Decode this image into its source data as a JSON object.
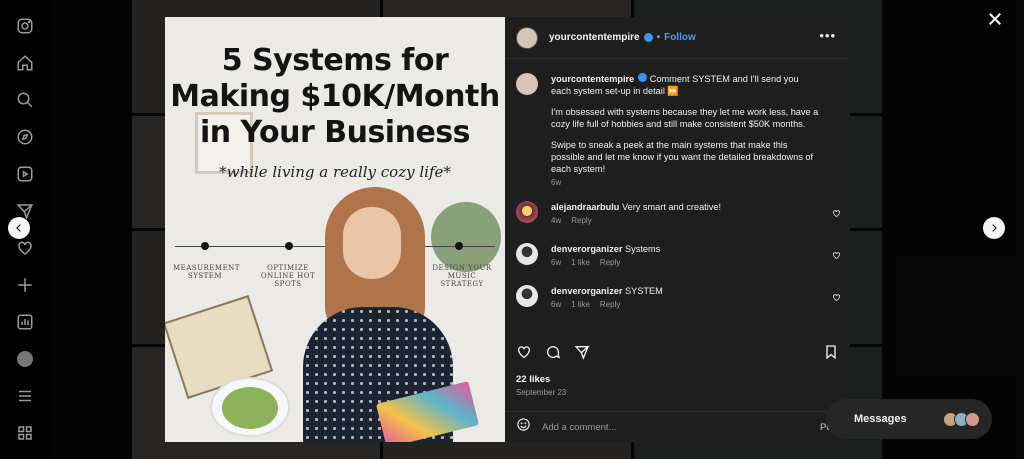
{
  "post": {
    "headline": "5 Systems for Making $10K/Month in Your Business",
    "subheadline": "*while living a really cozy life*",
    "timeline_labels": [
      "MEASUREMENT SYSTEM",
      "OPTIMIZE ONLINE HOT SPOTS",
      "DESIGN YOUR MUSIC STRATEGY"
    ]
  },
  "header": {
    "username": "yourcontentempire",
    "separator": "•",
    "follow_label": "Follow",
    "more_label": "•••"
  },
  "caption": {
    "username": "yourcontentempire",
    "text_1": " Comment SYSTEM and I'll send you each system set-up in detail ⏩",
    "text_2": "I'm obsessed with systems because they let me work less, have a cozy life full of hobbies and still make consistent $50K months.",
    "text_3": "Swipe to sneak a peek at the main systems that make this possible and let me know if you want the detailed breakdowns of each system!",
    "time": "6w"
  },
  "comments": [
    {
      "username": "alejandraarbulu",
      "text": " Very smart and creative!",
      "time": "4w",
      "likes": "",
      "reply": "Reply"
    },
    {
      "username": "denverorganizer",
      "text": " Systems",
      "time": "6w",
      "likes": "1 like",
      "reply": "Reply"
    },
    {
      "username": "denverorganizer",
      "text": " SYSTEM",
      "time": "6w",
      "likes": "1 like",
      "reply": "Reply"
    }
  ],
  "stats": {
    "likes": "22 likes",
    "date": "September 23"
  },
  "composer": {
    "placeholder": "Add a comment...",
    "post_label": "Post"
  },
  "messages": {
    "label": "Messages"
  },
  "colors": {
    "panel_bg": "#1e1e1e",
    "follow": "#4a9cf5",
    "verified": "#3897f0"
  }
}
